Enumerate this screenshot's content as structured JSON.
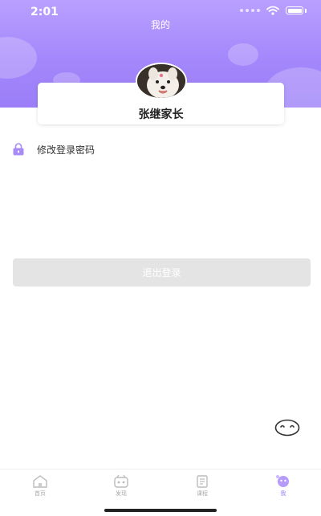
{
  "status_bar": {
    "time": "2:01"
  },
  "header": {
    "title": "我的"
  },
  "profile": {
    "name": "张继家长"
  },
  "menu": {
    "change_password": "修改登录密码"
  },
  "logout": {
    "label": "退出登录"
  },
  "tabs": [
    {
      "label": "首页",
      "icon": "home-icon",
      "active": false
    },
    {
      "label": "发现",
      "icon": "discover-icon",
      "active": false
    },
    {
      "label": "课程",
      "icon": "schedule-icon",
      "active": false
    },
    {
      "label": "我",
      "icon": "me-icon",
      "active": true
    }
  ],
  "colors": {
    "accent": "#9b7ef8",
    "header_top": "#b9a0ff",
    "button_disabled": "#e4e4e4"
  }
}
